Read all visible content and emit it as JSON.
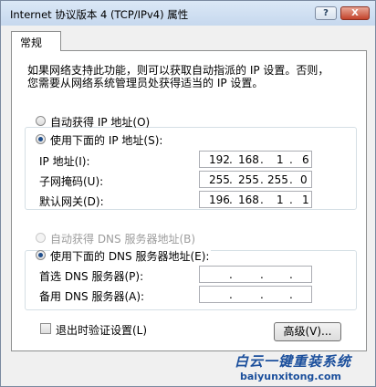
{
  "window": {
    "title": "Internet 协议版本 4 (TCP/IPv4) 属性",
    "help_label": "?",
    "close_label": "X"
  },
  "tab": {
    "label": "常规"
  },
  "intro": {
    "line1": "如果网络支持此功能，则可以获取自动指派的 IP 设置。否则，",
    "line2": "您需要从网络系统管理员处获得适当的 IP 设置。"
  },
  "ip_mode": {
    "auto_label": "自动获得 IP 地址(O)",
    "manual_label": "使用下面的 IP 地址(S):",
    "selected": "manual"
  },
  "ip_fields": [
    {
      "label": "IP 地址(I):",
      "octets": [
        "192",
        "168",
        "1",
        "6"
      ]
    },
    {
      "label": "子网掩码(U):",
      "octets": [
        "255",
        "255",
        "255",
        "0"
      ]
    },
    {
      "label": "默认网关(D):",
      "octets": [
        "196",
        "168",
        "1",
        "1"
      ]
    }
  ],
  "dns_mode": {
    "auto_label": "自动获得 DNS 服务器地址(B)",
    "manual_label": "使用下面的 DNS 服务器地址(E):",
    "selected": "manual"
  },
  "dns_fields": [
    {
      "label": "首选 DNS 服务器(P):",
      "octets": [
        "",
        "",
        "",
        ""
      ]
    },
    {
      "label": "备用 DNS 服务器(A):",
      "octets": [
        "",
        "",
        "",
        ""
      ]
    }
  ],
  "validate": {
    "label": "退出时验证设置(L)",
    "checked": false
  },
  "advanced_button": "高级(V)...",
  "watermark": {
    "line1": "白云一键重装系统",
    "line2": "baiyunxitong.com"
  },
  "colors": {
    "radio_dot": "#1f4e8c",
    "close": "#c3432b",
    "watermark": "#1b4f9c"
  }
}
